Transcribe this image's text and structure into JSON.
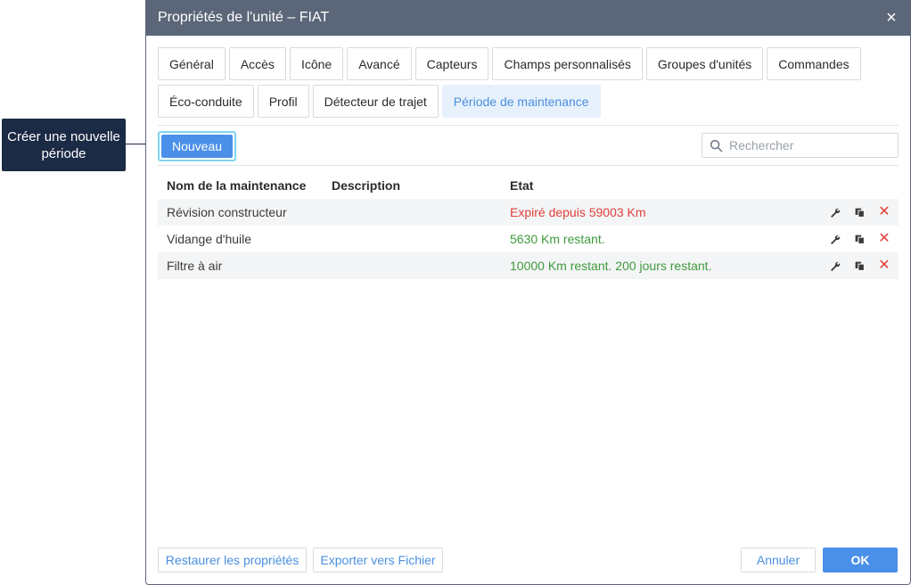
{
  "callout": {
    "text": "Créer une nouvelle période"
  },
  "dialog": {
    "title": "Propriétés de l'unité – FIAT",
    "close_label": "×",
    "tabs_row1": [
      "Général",
      "Accès",
      "Icône",
      "Avancé",
      "Capteurs",
      "Champs personnalisés",
      "Groupes d'unités",
      "Commandes"
    ],
    "tabs_row2": [
      "Éco-conduite",
      "Profil",
      "Détecteur de trajet",
      "Période de maintenance"
    ],
    "active_tab": "Période de maintenance",
    "new_button": "Nouveau",
    "search": {
      "placeholder": "Rechercher",
      "value": ""
    },
    "table": {
      "headers": {
        "name": "Nom de la maintenance",
        "description": "Description",
        "state": "Etat"
      },
      "rows": [
        {
          "name": "Révision constructeur",
          "description": "",
          "state": "Expiré depuis 59003 Km",
          "status": "expired"
        },
        {
          "name": "Vidange d'huile",
          "description": "",
          "state": "5630 Km restant.",
          "status": "ok"
        },
        {
          "name": "Filtre à air",
          "description": "",
          "state": "10000 Km restant. 200 jours restant.",
          "status": "ok"
        }
      ],
      "row_actions": {
        "edit": "wrench-icon",
        "copy": "copy-icon",
        "delete": "delete-icon"
      }
    },
    "footer": {
      "restore": "Restaurer les propriétés",
      "export": "Exporter vers Fichier",
      "cancel": "Annuler",
      "ok": "OK"
    },
    "colors": {
      "titlebar": "#5b6678",
      "accent": "#4a8fe8",
      "expired": "#e0403a",
      "ok": "#3f9a3c"
    }
  }
}
